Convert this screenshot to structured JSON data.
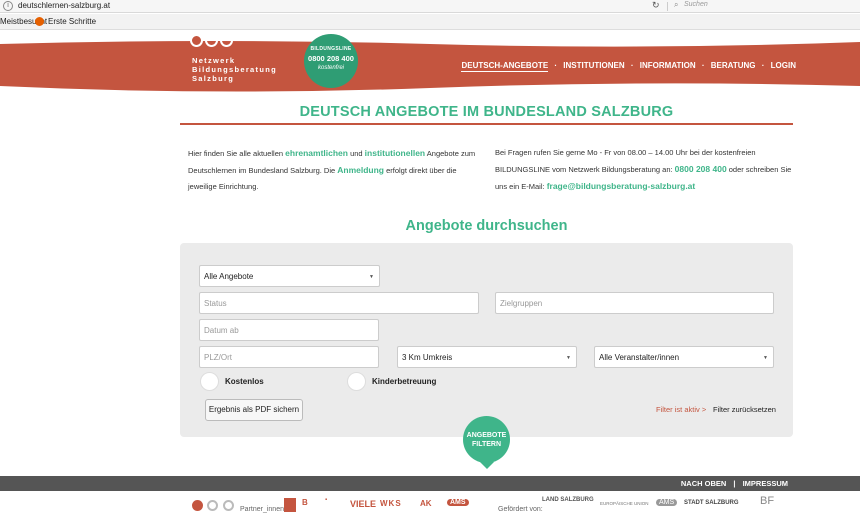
{
  "browser": {
    "url": "deutschlernen-salzburg.at",
    "search_placeholder": "Suchen",
    "bookmarks": [
      "Meistbesucht",
      "Erste Schritte"
    ]
  },
  "header": {
    "logo_lines": [
      "Netzwerk",
      "Bildungsberatung",
      "Salzburg"
    ],
    "badge": {
      "top": "BILDUNGSLINE",
      "phone": "0800 208 400",
      "free": "kostenfrei"
    },
    "nav": [
      "DEUTSCH-ANGEBOTE",
      "INSTITUTIONEN",
      "INFORMATION",
      "BERATUNG",
      "LOGIN"
    ]
  },
  "page_title": "DEUTSCH ANGEBOTE IM BUNDESLAND SALZBURG",
  "intro_left": {
    "t1": "Hier finden Sie alle aktuellen ",
    "h1": "ehrenamtlichen",
    "t2": " und ",
    "h2": "institutionellen",
    "t3": " Angebote zum Deutschlernen im Bundesland Salzburg. Die ",
    "h3": "Anmeldung",
    "t4": " erfolgt direkt über die jeweilige Einrichtung."
  },
  "intro_right": {
    "t1": "Bei Fragen rufen Sie gerne Mo - Fr von 08.00 – 14.00 Uhr bei der kostenfreien BILDUNGSLINE vom Netzwerk Bildungsberatung an: ",
    "phone": "0800 208 400",
    "t2": " oder schreiben Sie uns ein E-Mail: ",
    "email": "frage@bildungsberatung-salzburg.at"
  },
  "search": {
    "heading": "Angebote durchsuchen",
    "offer_type": "Alle Angebote",
    "status_placeholder": "Status",
    "target_placeholder": "Zielgruppen",
    "date_placeholder": "Datum ab",
    "zip_placeholder": "PLZ/Ort",
    "radius": "3 Km Umkreis",
    "organizer": "Alle Veranstalter/innen",
    "free_label": "Kostenlos",
    "childcare_label": "Kinderbetreuung",
    "pdf_button": "Ergebnis als PDF sichern",
    "filter_active": "Filter ist aktiv >",
    "filter_reset": "Filter zurücksetzen",
    "filter_button": [
      "ANGEBOTE",
      "FILTERN"
    ]
  },
  "footer": {
    "links": [
      "NACH OBEN",
      "IMPRESSUM"
    ],
    "partners_label": "Partner_innen:",
    "funded_label": "Gefördert von:",
    "partner_logos": [
      "VIELE",
      "WKS",
      "AK",
      "AMS"
    ],
    "funder_logos": [
      "LAND SALZBURG",
      "EUROPÄISCHE UNION",
      "AMS",
      "STADT SALZBURG",
      "BF"
    ]
  }
}
